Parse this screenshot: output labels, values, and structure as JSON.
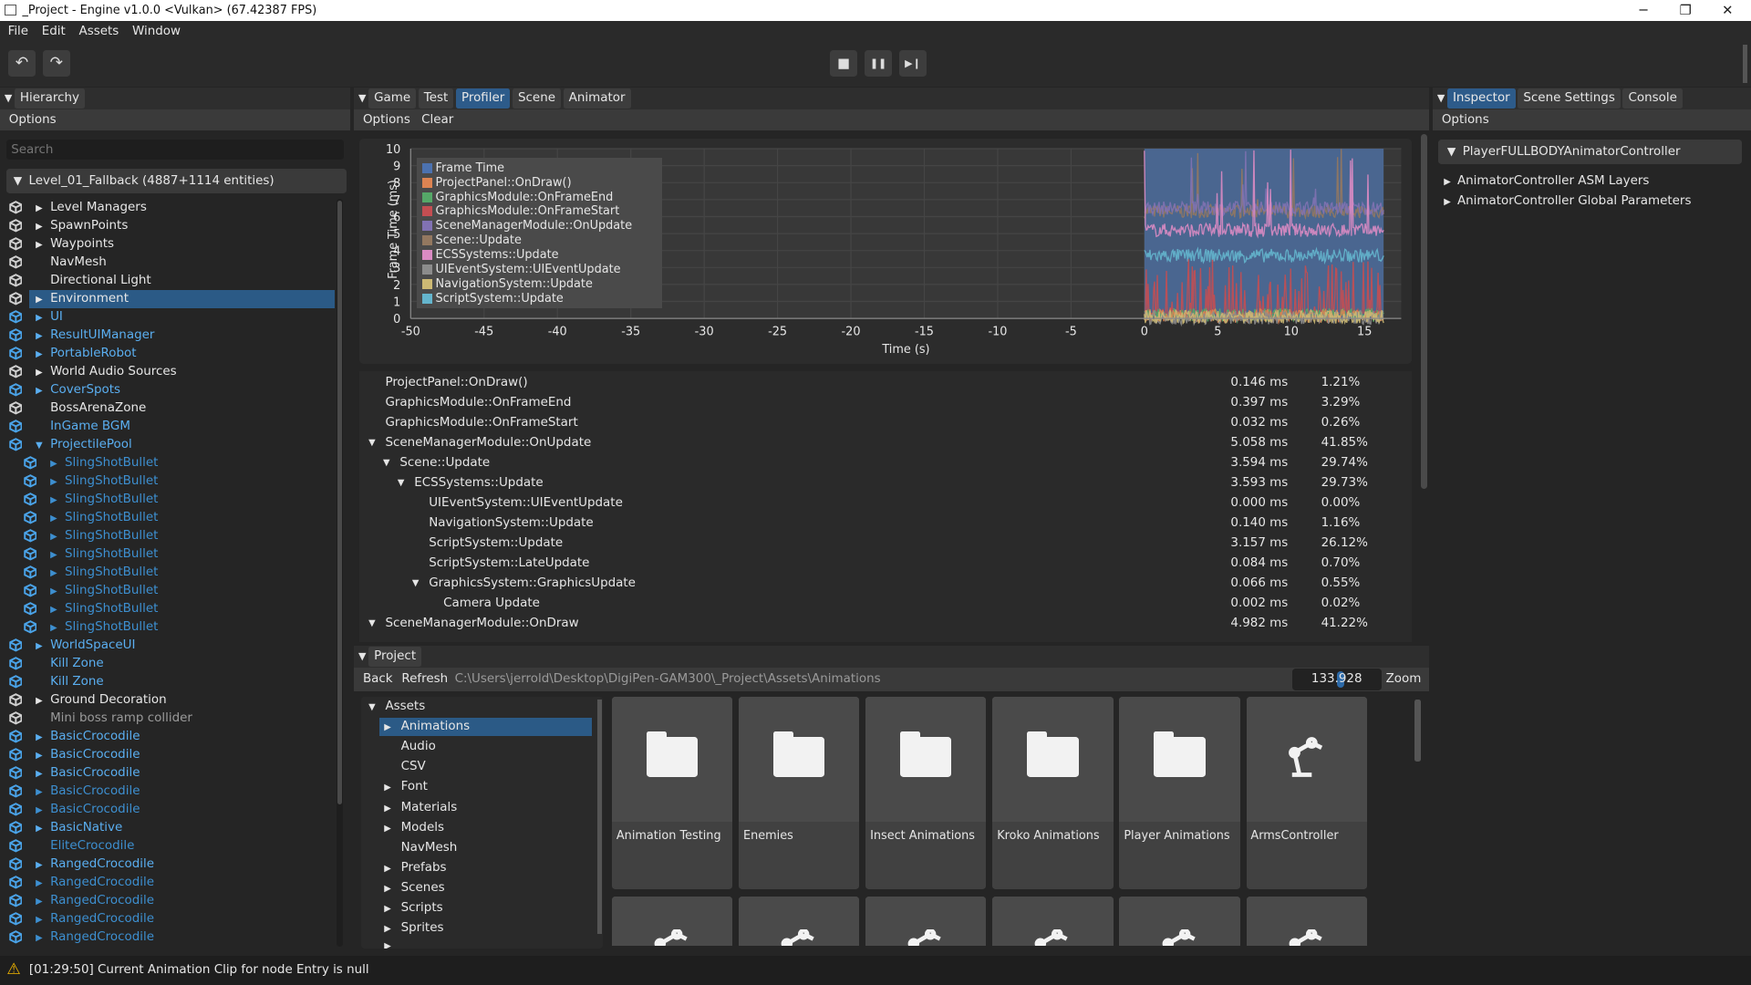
{
  "window": {
    "title": "_Project - Engine v1.0.0 <Vulkan> (67.42387 FPS)",
    "minimize": "─",
    "maximize": "❐",
    "close": "✕"
  },
  "menu": [
    "File",
    "Edit",
    "Assets",
    "Window"
  ],
  "toolbar": {
    "undo": "↶",
    "redo": "↷",
    "stop": "■",
    "pause": "❚❚",
    "step": "▶❙"
  },
  "hierarchy": {
    "tab": "Hierarchy",
    "options": "Options",
    "search_placeholder": "Search",
    "scene": "Level_01_Fallback (4887+1114 entities)",
    "items": [
      {
        "label": "Level Managers",
        "arrow": true,
        "c": "w",
        "i": 0
      },
      {
        "label": "SpawnPoints",
        "arrow": true,
        "c": "w",
        "i": 0
      },
      {
        "label": "Waypoints",
        "arrow": true,
        "c": "w",
        "i": 0
      },
      {
        "label": "NavMesh",
        "arrow": false,
        "c": "w",
        "i": 0
      },
      {
        "label": "Directional Light",
        "arrow": false,
        "c": "w",
        "i": 0
      },
      {
        "label": "Environment",
        "arrow": true,
        "c": "w",
        "i": 0,
        "selected": true
      },
      {
        "label": "UI",
        "arrow": true,
        "c": "b",
        "i": 0
      },
      {
        "label": "ResultUIManager",
        "arrow": true,
        "c": "b",
        "i": 0
      },
      {
        "label": "PortableRobot",
        "arrow": true,
        "c": "b",
        "i": 0
      },
      {
        "label": "World Audio Sources",
        "arrow": true,
        "c": "w",
        "i": 0
      },
      {
        "label": "CoverSpots",
        "arrow": true,
        "c": "b",
        "i": 0
      },
      {
        "label": "BossArenaZone",
        "arrow": false,
        "c": "w",
        "i": 0
      },
      {
        "label": "InGame BGM",
        "arrow": false,
        "c": "b",
        "i": 0
      },
      {
        "label": "ProjectilePool",
        "arrow": true,
        "open": true,
        "c": "b",
        "i": 0
      },
      {
        "label": "SlingShotBullet",
        "arrow": true,
        "c": "d",
        "i": 1
      },
      {
        "label": "SlingShotBullet",
        "arrow": true,
        "c": "d",
        "i": 1
      },
      {
        "label": "SlingShotBullet",
        "arrow": true,
        "c": "d",
        "i": 1
      },
      {
        "label": "SlingShotBullet",
        "arrow": true,
        "c": "d",
        "i": 1
      },
      {
        "label": "SlingShotBullet",
        "arrow": true,
        "c": "d",
        "i": 1
      },
      {
        "label": "SlingShotBullet",
        "arrow": true,
        "c": "d",
        "i": 1
      },
      {
        "label": "SlingShotBullet",
        "arrow": true,
        "c": "d",
        "i": 1
      },
      {
        "label": "SlingShotBullet",
        "arrow": true,
        "c": "d",
        "i": 1
      },
      {
        "label": "SlingShotBullet",
        "arrow": true,
        "c": "d",
        "i": 1
      },
      {
        "label": "SlingShotBullet",
        "arrow": true,
        "c": "d",
        "i": 1
      },
      {
        "label": "WorldSpaceUI",
        "arrow": true,
        "c": "b",
        "i": 0
      },
      {
        "label": "Kill Zone",
        "arrow": false,
        "c": "b",
        "i": 0
      },
      {
        "label": "Kill Zone",
        "arrow": false,
        "c": "b",
        "i": 0
      },
      {
        "label": "Ground Decoration",
        "arrow": true,
        "c": "w",
        "i": 0
      },
      {
        "label": "Mini boss ramp collider",
        "arrow": false,
        "c": "g",
        "i": 0
      },
      {
        "label": "BasicCrocodile",
        "arrow": true,
        "c": "b",
        "i": 0
      },
      {
        "label": "BasicCrocodile",
        "arrow": true,
        "c": "b",
        "i": 0
      },
      {
        "label": "BasicCrocodile",
        "arrow": true,
        "c": "b",
        "i": 0
      },
      {
        "label": "BasicCrocodile",
        "arrow": true,
        "c": "d",
        "i": 0
      },
      {
        "label": "BasicCrocodile",
        "arrow": true,
        "c": "d",
        "i": 0
      },
      {
        "label": "BasicNative",
        "arrow": true,
        "c": "b",
        "i": 0
      },
      {
        "label": "EliteCrocodile",
        "arrow": false,
        "c": "d",
        "i": 0
      },
      {
        "label": "RangedCrocodile",
        "arrow": true,
        "c": "b",
        "i": 0
      },
      {
        "label": "RangedCrocodile",
        "arrow": true,
        "c": "d",
        "i": 0
      },
      {
        "label": "RangedCrocodile",
        "arrow": true,
        "c": "d",
        "i": 0
      },
      {
        "label": "RangedCrocodile",
        "arrow": true,
        "c": "d",
        "i": 0
      },
      {
        "label": "RangedCrocodile",
        "arrow": true,
        "c": "d",
        "i": 0
      }
    ]
  },
  "center": {
    "tabs": [
      "Game",
      "Test",
      "Profiler",
      "Scene",
      "Animator"
    ],
    "active_tab": "Profiler",
    "options": "Options",
    "clear": "Clear"
  },
  "profiler_chart": {
    "ylabel": "Frame Time (ms)",
    "xlabel": "Time (s)",
    "yticks": [
      "0",
      "1",
      "2",
      "3",
      "4",
      "5",
      "6",
      "7",
      "8",
      "9",
      "10"
    ],
    "xticks": [
      "-50",
      "-45",
      "-40",
      "-35",
      "-30",
      "-25",
      "-20",
      "-15",
      "-10",
      "-5",
      "0",
      "5",
      "10",
      "15"
    ],
    "legend": [
      {
        "name": "Frame Time",
        "color": "#4c72b0"
      },
      {
        "name": "ProjectPanel::OnDraw()",
        "color": "#dd8452"
      },
      {
        "name": "GraphicsModule::OnFrameEnd",
        "color": "#55a868"
      },
      {
        "name": "GraphicsModule::OnFrameStart",
        "color": "#c44e52"
      },
      {
        "name": "SceneManagerModule::OnUpdate",
        "color": "#8172b3"
      },
      {
        "name": "Scene::Update",
        "color": "#937860"
      },
      {
        "name": "ECSSystems::Update",
        "color": "#da8bc3"
      },
      {
        "name": "UIEventSystem::UIEventUpdate",
        "color": "#8c8c8c"
      },
      {
        "name": "NavigationSystem::Update",
        "color": "#ccb974"
      },
      {
        "name": "ScriptSystem::Update",
        "color": "#64b5cd"
      }
    ]
  },
  "profiler_rows": [
    {
      "name": "ProjectPanel::OnDraw()",
      "ms": "0.146 ms",
      "pct": "1.21%",
      "lvl": 0
    },
    {
      "name": "GraphicsModule::OnFrameEnd",
      "ms": "0.397 ms",
      "pct": "3.29%",
      "lvl": 0
    },
    {
      "name": "GraphicsModule::OnFrameStart",
      "ms": "0.032 ms",
      "pct": "0.26%",
      "lvl": 0
    },
    {
      "name": "SceneManagerModule::OnUpdate",
      "ms": "5.058 ms",
      "pct": "41.85%",
      "lvl": 0,
      "open": true
    },
    {
      "name": "Scene::Update",
      "ms": "3.594 ms",
      "pct": "29.74%",
      "lvl": 1,
      "open": true
    },
    {
      "name": "ECSSystems::Update",
      "ms": "3.593 ms",
      "pct": "29.73%",
      "lvl": 2,
      "open": true
    },
    {
      "name": "UIEventSystem::UIEventUpdate",
      "ms": "0.000 ms",
      "pct": "0.00%",
      "lvl": 3
    },
    {
      "name": "NavigationSystem::Update",
      "ms": "0.140 ms",
      "pct": "1.16%",
      "lvl": 3
    },
    {
      "name": "ScriptSystem::Update",
      "ms": "3.157 ms",
      "pct": "26.12%",
      "lvl": 3
    },
    {
      "name": "ScriptSystem::LateUpdate",
      "ms": "0.084 ms",
      "pct": "0.70%",
      "lvl": 3
    },
    {
      "name": "GraphicsSystem::GraphicsUpdate",
      "ms": "0.066 ms",
      "pct": "0.55%",
      "lvl": 3,
      "open": true
    },
    {
      "name": "Camera Update",
      "ms": "0.002 ms",
      "pct": "0.02%",
      "lvl": 4
    },
    {
      "name": "SceneManagerModule::OnDraw",
      "ms": "4.982 ms",
      "pct": "41.22%",
      "lvl": 0,
      "open": true
    }
  ],
  "project": {
    "tab": "Project",
    "back": "Back",
    "refresh": "Refresh",
    "path": "C:\\Users\\jerrold\\Desktop\\DigiPen-GAM300\\_Project\\Assets\\Animations",
    "zoom_value": "133.928",
    "zoom_label": "Zoom",
    "tree_root": "Assets",
    "tree": [
      {
        "label": "Animations",
        "arrow": true,
        "selected": true
      },
      {
        "label": "Audio",
        "arrow": false
      },
      {
        "label": "CSV",
        "arrow": false
      },
      {
        "label": "Font",
        "arrow": true
      },
      {
        "label": "Materials",
        "arrow": true
      },
      {
        "label": "Models",
        "arrow": true
      },
      {
        "label": "NavMesh",
        "arrow": false
      },
      {
        "label": "Prefabs",
        "arrow": true
      },
      {
        "label": "Scenes",
        "arrow": true
      },
      {
        "label": "Scripts",
        "arrow": true
      },
      {
        "label": "Sprites",
        "arrow": true
      }
    ],
    "tiles": [
      {
        "label": "Animation Testing",
        "icon": "folder"
      },
      {
        "label": "Enemies",
        "icon": "folder"
      },
      {
        "label": "Insect Animations",
        "icon": "folder"
      },
      {
        "label": "Kroko Animations",
        "icon": "folder"
      },
      {
        "label": "Player Animations",
        "icon": "folder"
      },
      {
        "label": "ArmsController",
        "icon": "animator-controller"
      }
    ]
  },
  "inspector": {
    "tabs": [
      "Inspector",
      "Scene Settings",
      "Console"
    ],
    "active_tab": "Inspector",
    "options": "Options",
    "component": "PlayerFULLBODYAnimatorController",
    "children": [
      "AnimatorController ASM Layers",
      "AnimatorController Global Parameters"
    ]
  },
  "status": {
    "message": "[01:29:50] Current Animation Clip for node Entry is null",
    "icon": "warning-icon"
  }
}
